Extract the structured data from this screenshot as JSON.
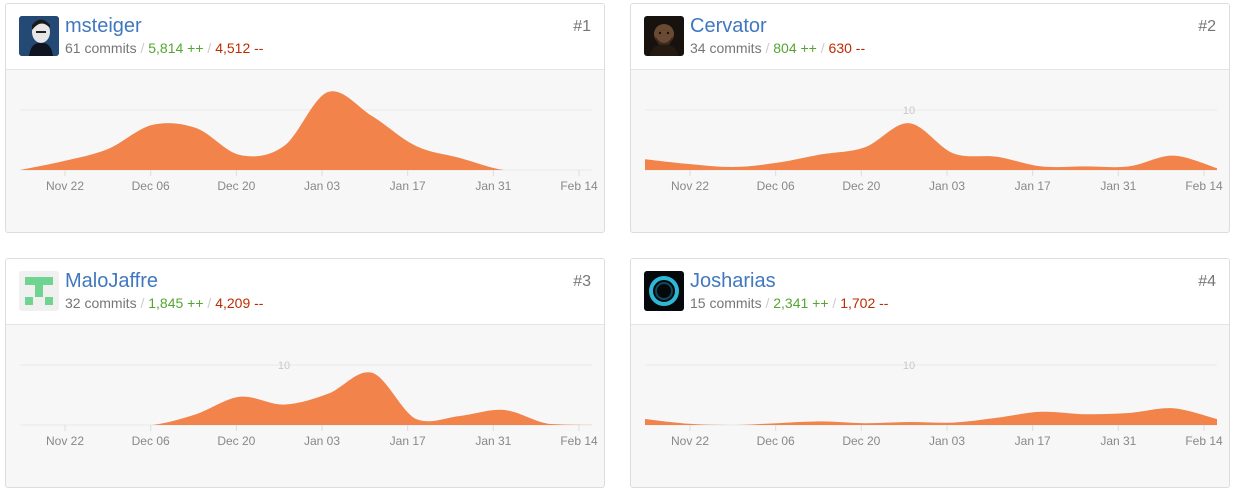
{
  "axis": {
    "dates": [
      "Nov 22",
      "Dec 06",
      "Dec 20",
      "Jan 03",
      "Jan 17",
      "Jan 31",
      "Feb 14"
    ],
    "ytick": "10"
  },
  "colors": {
    "area": "#f1834b",
    "username": "#4078c0",
    "additions": "#55a532",
    "deletions": "#bd2c00"
  },
  "contributors": [
    {
      "rank": "#1",
      "username": "msteiger",
      "avatar_icon": "portrait-avatar-icon",
      "commits": "61 commits",
      "additions": "5,814 ++",
      "deletions": "4,512 --",
      "show_ytick": false
    },
    {
      "rank": "#2",
      "username": "Cervator",
      "avatar_icon": "portrait-avatar-icon",
      "commits": "34 commits",
      "additions": "804 ++",
      "deletions": "630 --",
      "show_ytick": true
    },
    {
      "rank": "#3",
      "username": "MaloJaffre",
      "avatar_icon": "identicon-avatar-icon",
      "commits": "32 commits",
      "additions": "1,845 ++",
      "deletions": "4,209 --",
      "show_ytick": true
    },
    {
      "rank": "#4",
      "username": "Josharias",
      "avatar_icon": "ring-avatar-icon",
      "commits": "15 commits",
      "additions": "2,341 ++",
      "deletions": "1,702 --",
      "show_ytick": true
    }
  ],
  "chart_data": [
    {
      "type": "area",
      "title": "",
      "x": [
        "Nov 15",
        "Nov 22",
        "Nov 29",
        "Dec 06",
        "Dec 13",
        "Dec 20",
        "Dec 27",
        "Jan 03",
        "Jan 10",
        "Jan 17",
        "Jan 24",
        "Jan 31",
        "Feb 07",
        "Feb 14"
      ],
      "values": [
        0,
        1.5,
        3.5,
        7.5,
        7,
        2.5,
        4,
        13,
        9,
        4,
        2,
        0,
        0,
        0
      ],
      "ylim": [
        0,
        15
      ]
    },
    {
      "type": "area",
      "title": "",
      "x": [
        "Nov 15",
        "Nov 22",
        "Nov 29",
        "Dec 06",
        "Dec 13",
        "Dec 20",
        "Dec 27",
        "Jan 03",
        "Jan 10",
        "Jan 17",
        "Jan 24",
        "Jan 31",
        "Feb 07",
        "Feb 14"
      ],
      "values": [
        1.8,
        1.0,
        0.5,
        1.2,
        2.6,
        3.8,
        7.8,
        2.8,
        2.2,
        0.6,
        0.6,
        0.6,
        2.4,
        0.3
      ],
      "ylim": [
        0,
        15
      ]
    },
    {
      "type": "area",
      "title": "",
      "x": [
        "Nov 15",
        "Nov 22",
        "Nov 29",
        "Dec 06",
        "Dec 13",
        "Dec 20",
        "Dec 27",
        "Jan 03",
        "Jan 10",
        "Jan 17",
        "Jan 24",
        "Jan 31",
        "Feb 07",
        "Feb 14"
      ],
      "values": [
        0,
        0,
        0,
        0,
        1.8,
        4.7,
        3.4,
        5.2,
        8.7,
        1.0,
        1.5,
        2.5,
        0.2,
        0
      ],
      "ylim": [
        0,
        15
      ]
    },
    {
      "type": "area",
      "title": "",
      "x": [
        "Nov 15",
        "Nov 22",
        "Nov 29",
        "Dec 06",
        "Dec 13",
        "Dec 20",
        "Dec 27",
        "Jan 03",
        "Jan 10",
        "Jan 17",
        "Jan 24",
        "Jan 31",
        "Feb 07",
        "Feb 14"
      ],
      "values": [
        1.0,
        0.2,
        0,
        0.3,
        0.6,
        0.3,
        0.5,
        0.4,
        1.2,
        2.2,
        1.8,
        2.0,
        2.8,
        1.0
      ],
      "ylim": [
        0,
        15
      ]
    }
  ]
}
